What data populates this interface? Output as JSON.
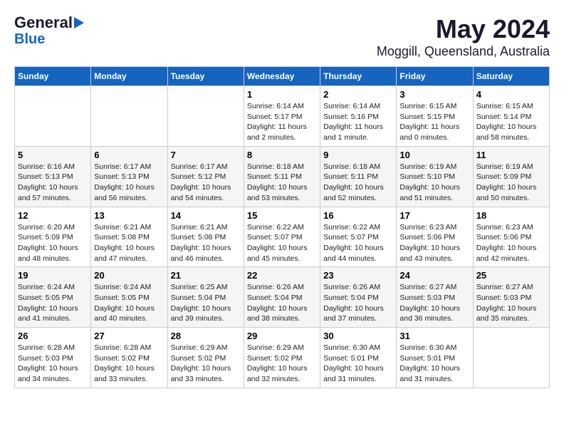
{
  "header": {
    "logo_line1": "General",
    "logo_line2": "Blue",
    "title": "May 2024",
    "subtitle": "Moggill, Queensland, Australia"
  },
  "calendar": {
    "days_of_week": [
      "Sunday",
      "Monday",
      "Tuesday",
      "Wednesday",
      "Thursday",
      "Friday",
      "Saturday"
    ],
    "weeks": [
      [
        {
          "day": "",
          "info": ""
        },
        {
          "day": "",
          "info": ""
        },
        {
          "day": "",
          "info": ""
        },
        {
          "day": "1",
          "info": "Sunrise: 6:14 AM\nSunset: 5:17 PM\nDaylight: 11 hours\nand 2 minutes."
        },
        {
          "day": "2",
          "info": "Sunrise: 6:14 AM\nSunset: 5:16 PM\nDaylight: 11 hours\nand 1 minute."
        },
        {
          "day": "3",
          "info": "Sunrise: 6:15 AM\nSunset: 5:15 PM\nDaylight: 11 hours\nand 0 minutes."
        },
        {
          "day": "4",
          "info": "Sunrise: 6:15 AM\nSunset: 5:14 PM\nDaylight: 10 hours\nand 58 minutes."
        }
      ],
      [
        {
          "day": "5",
          "info": "Sunrise: 6:16 AM\nSunset: 5:13 PM\nDaylight: 10 hours\nand 57 minutes."
        },
        {
          "day": "6",
          "info": "Sunrise: 6:17 AM\nSunset: 5:13 PM\nDaylight: 10 hours\nand 56 minutes."
        },
        {
          "day": "7",
          "info": "Sunrise: 6:17 AM\nSunset: 5:12 PM\nDaylight: 10 hours\nand 54 minutes."
        },
        {
          "day": "8",
          "info": "Sunrise: 6:18 AM\nSunset: 5:11 PM\nDaylight: 10 hours\nand 53 minutes."
        },
        {
          "day": "9",
          "info": "Sunrise: 6:18 AM\nSunset: 5:11 PM\nDaylight: 10 hours\nand 52 minutes."
        },
        {
          "day": "10",
          "info": "Sunrise: 6:19 AM\nSunset: 5:10 PM\nDaylight: 10 hours\nand 51 minutes."
        },
        {
          "day": "11",
          "info": "Sunrise: 6:19 AM\nSunset: 5:09 PM\nDaylight: 10 hours\nand 50 minutes."
        }
      ],
      [
        {
          "day": "12",
          "info": "Sunrise: 6:20 AM\nSunset: 5:09 PM\nDaylight: 10 hours\nand 48 minutes."
        },
        {
          "day": "13",
          "info": "Sunrise: 6:21 AM\nSunset: 5:08 PM\nDaylight: 10 hours\nand 47 minutes."
        },
        {
          "day": "14",
          "info": "Sunrise: 6:21 AM\nSunset: 5:08 PM\nDaylight: 10 hours\nand 46 minutes."
        },
        {
          "day": "15",
          "info": "Sunrise: 6:22 AM\nSunset: 5:07 PM\nDaylight: 10 hours\nand 45 minutes."
        },
        {
          "day": "16",
          "info": "Sunrise: 6:22 AM\nSunset: 5:07 PM\nDaylight: 10 hours\nand 44 minutes."
        },
        {
          "day": "17",
          "info": "Sunrise: 6:23 AM\nSunset: 5:06 PM\nDaylight: 10 hours\nand 43 minutes."
        },
        {
          "day": "18",
          "info": "Sunrise: 6:23 AM\nSunset: 5:06 PM\nDaylight: 10 hours\nand 42 minutes."
        }
      ],
      [
        {
          "day": "19",
          "info": "Sunrise: 6:24 AM\nSunset: 5:05 PM\nDaylight: 10 hours\nand 41 minutes."
        },
        {
          "day": "20",
          "info": "Sunrise: 6:24 AM\nSunset: 5:05 PM\nDaylight: 10 hours\nand 40 minutes."
        },
        {
          "day": "21",
          "info": "Sunrise: 6:25 AM\nSunset: 5:04 PM\nDaylight: 10 hours\nand 39 minutes."
        },
        {
          "day": "22",
          "info": "Sunrise: 6:26 AM\nSunset: 5:04 PM\nDaylight: 10 hours\nand 38 minutes."
        },
        {
          "day": "23",
          "info": "Sunrise: 6:26 AM\nSunset: 5:04 PM\nDaylight: 10 hours\nand 37 minutes."
        },
        {
          "day": "24",
          "info": "Sunrise: 6:27 AM\nSunset: 5:03 PM\nDaylight: 10 hours\nand 36 minutes."
        },
        {
          "day": "25",
          "info": "Sunrise: 6:27 AM\nSunset: 5:03 PM\nDaylight: 10 hours\nand 35 minutes."
        }
      ],
      [
        {
          "day": "26",
          "info": "Sunrise: 6:28 AM\nSunset: 5:03 PM\nDaylight: 10 hours\nand 34 minutes."
        },
        {
          "day": "27",
          "info": "Sunrise: 6:28 AM\nSunset: 5:02 PM\nDaylight: 10 hours\nand 33 minutes."
        },
        {
          "day": "28",
          "info": "Sunrise: 6:29 AM\nSunset: 5:02 PM\nDaylight: 10 hours\nand 33 minutes."
        },
        {
          "day": "29",
          "info": "Sunrise: 6:29 AM\nSunset: 5:02 PM\nDaylight: 10 hours\nand 32 minutes."
        },
        {
          "day": "30",
          "info": "Sunrise: 6:30 AM\nSunset: 5:01 PM\nDaylight: 10 hours\nand 31 minutes."
        },
        {
          "day": "31",
          "info": "Sunrise: 6:30 AM\nSunset: 5:01 PM\nDaylight: 10 hours\nand 31 minutes."
        },
        {
          "day": "",
          "info": ""
        }
      ]
    ]
  }
}
